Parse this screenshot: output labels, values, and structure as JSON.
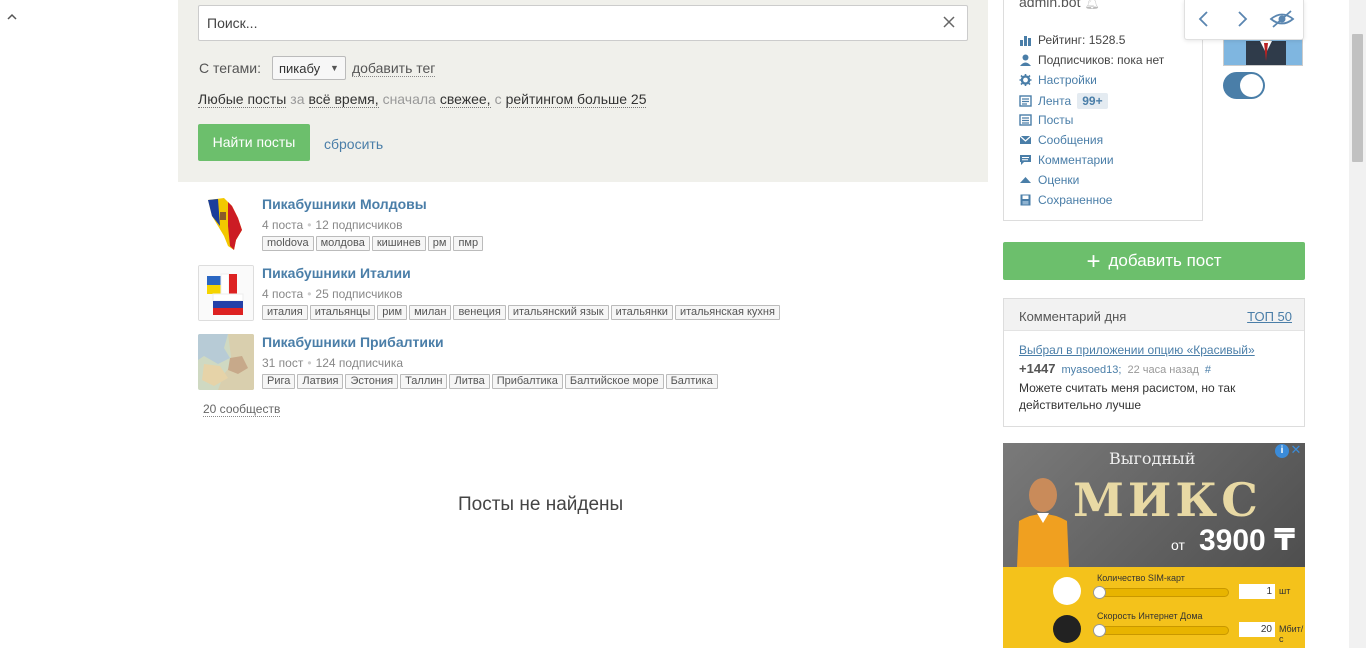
{
  "search": {
    "placeholder": "Поиск...",
    "tags_label": "С тегами:",
    "selected_tag": "пикабу",
    "add_tag": "добавить тег",
    "filter": {
      "any_posts": "Любые посты",
      "for": "за",
      "period": "всё время,",
      "first": "сначала",
      "sort": "свежее,",
      "with": "с",
      "rating": "рейтингом больше 25"
    },
    "find_button": "Найти посты",
    "reset": "сбросить"
  },
  "communities": [
    {
      "name": "Пикабушники Молдовы",
      "posts": "4 поста",
      "subscribers": "12 подписчиков",
      "tags": [
        "moldova",
        "молдова",
        "кишинев",
        "рм",
        "пмр"
      ]
    },
    {
      "name": "Пикабушники Италии",
      "posts": "4 поста",
      "subscribers": "25 подписчиков",
      "tags": [
        "италия",
        "итальянцы",
        "рим",
        "милан",
        "венеция",
        "итальянский язык",
        "итальянки",
        "итальянская кухня"
      ]
    },
    {
      "name": "Пикабушники Прибалтики",
      "posts": "31 пост",
      "subscribers": "124 подписчика",
      "tags": [
        "Рига",
        "Латвия",
        "Эстония",
        "Таллин",
        "Литва",
        "Прибалтика",
        "Балтийское море",
        "Балтика"
      ]
    }
  ],
  "all_communities": "20 сообществ",
  "no_posts": "Посты не найдены",
  "profile": {
    "username": "admin.bot",
    "menu": [
      {
        "icon": "bar-chart-icon",
        "label": "Рейтинг: 1528.5"
      },
      {
        "icon": "person-icon",
        "label": "Подписчиков: пока нет"
      },
      {
        "icon": "gear-icon",
        "label": "Настройки"
      },
      {
        "icon": "feed-icon",
        "label": "Лента"
      },
      {
        "icon": "posts-icon",
        "label": "Посты"
      },
      {
        "icon": "envelope-icon",
        "label": "Сообщения"
      },
      {
        "icon": "comment-icon",
        "label": "Комментарии"
      },
      {
        "icon": "triangle-up-icon",
        "label": "Оценки"
      },
      {
        "icon": "save-icon",
        "label": "Сохраненное"
      }
    ],
    "feed_badge": "99+"
  },
  "add_post": "добавить пост",
  "comment_of_day": {
    "title": "Комментарий дня",
    "top_link": "ТОП 50",
    "post_link": "Выбрал в приложении опцию «Красивый»",
    "score": "+1447",
    "author": "myasoed13;",
    "time": "22 часа назад",
    "hash": "#",
    "text": "Можете считать меня расистом, но так действительно лучше"
  },
  "ad": {
    "headline": "Выгодный",
    "big": "МИКС",
    "price_prefix": "от",
    "price": "3900 ₸",
    "sim_label": "Количество SIM-карт",
    "sim_value": "1",
    "sim_unit": "шт",
    "speed_label": "Скорость Интернет Дома",
    "speed_value": "20",
    "speed_unit": "Мбит/с"
  },
  "colors": {
    "accent_green": "#6cbf6c",
    "link_blue": "#4a7ea8",
    "panel_bg": "#f0f0eb"
  }
}
